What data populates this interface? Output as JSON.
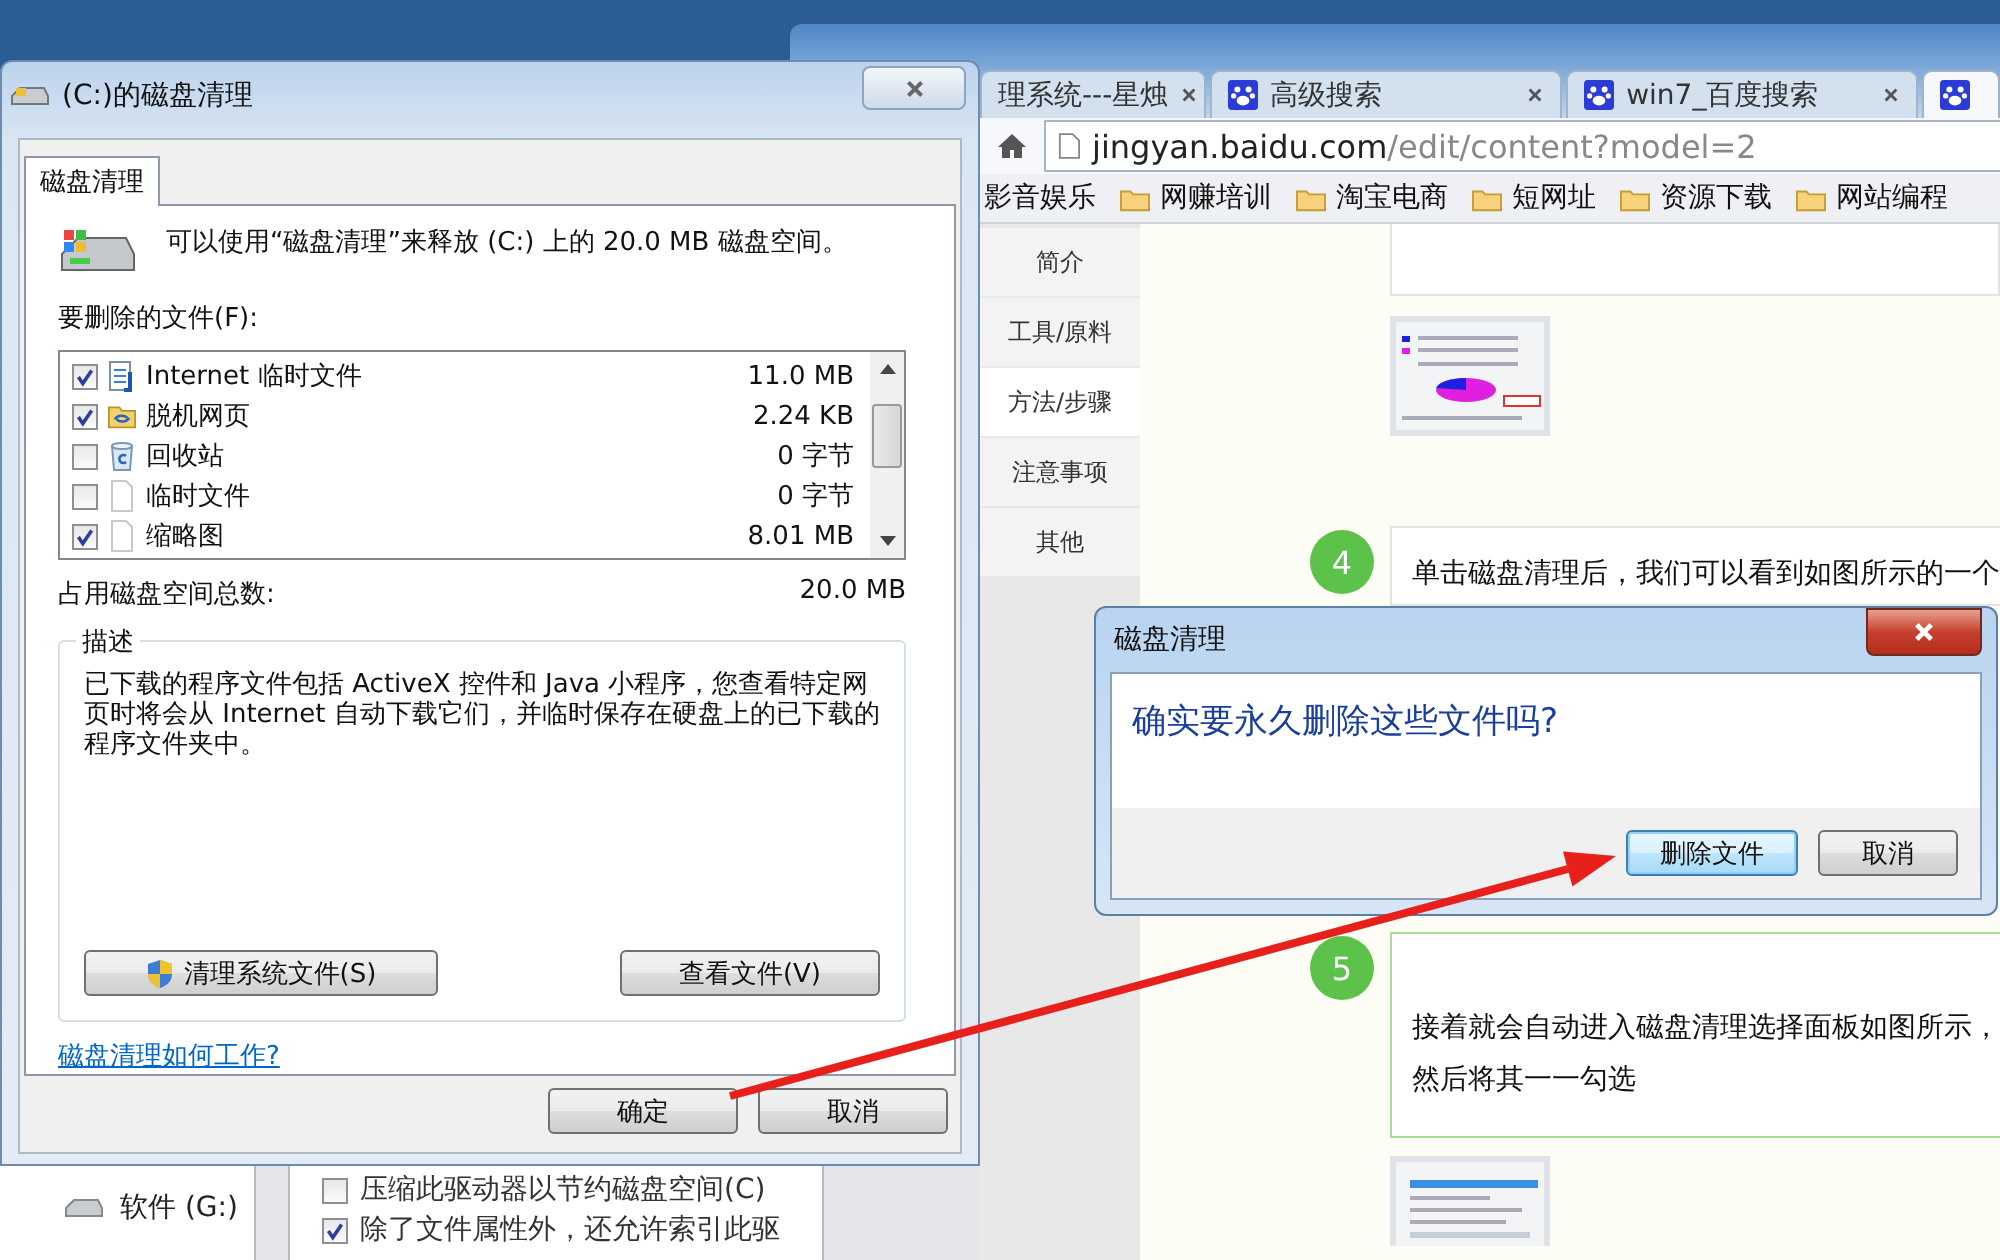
{
  "cleanup_dialog": {
    "title": "(C:)的磁盘清理",
    "tab": "磁盘清理",
    "summary": "可以使用“磁盘清理”来释放 (C:) 上的 20.0 MB 磁盘空间。",
    "files_label": "要删除的文件(F):",
    "files": [
      {
        "kind": "internet",
        "name": "Internet 临时文件",
        "size": "11.0 MB",
        "checked": true
      },
      {
        "kind": "offline",
        "name": "脱机网页",
        "size": "2.24 KB",
        "checked": true
      },
      {
        "kind": "recycle",
        "name": "回收站",
        "size": "0 字节",
        "checked": false
      },
      {
        "kind": "file",
        "name": "临时文件",
        "size": "0 字节",
        "checked": false
      },
      {
        "kind": "file",
        "name": "缩略图",
        "size": "8.01 MB",
        "checked": true
      }
    ],
    "total_label": "占用磁盘空间总数:",
    "total_value": "20.0 MB",
    "description_label": "描述",
    "description": "已下载的程序文件包括 ActiveX 控件和 Java 小程序，您查看特定网页时将会从 Internet 自动下载它们，并临时保存在硬盘上的已下载的程序文件夹中。",
    "system_files_button": "清理系统文件(S)",
    "view_files_button": "查看文件(V)",
    "help_link": "磁盘清理如何工作?",
    "ok_button": "确定",
    "cancel_button": "取消"
  },
  "browser": {
    "tabs": [
      {
        "title": "理系统---星烛",
        "icon": false,
        "close": true,
        "selected": false
      },
      {
        "title": "高级搜索",
        "icon": true,
        "close": true,
        "selected": false
      },
      {
        "title": "win7_百度搜索",
        "icon": true,
        "close": true,
        "selected": false
      },
      {
        "icon": true,
        "close": false,
        "selected": true
      }
    ],
    "url_host": "jingyan.baidu.com",
    "url_path": "/edit/content?model=2",
    "bookmarks": [
      {
        "label": "影音娱乐",
        "folder": false
      },
      {
        "label": "网赚培训",
        "folder": true
      },
      {
        "label": "淘宝电商",
        "folder": true
      },
      {
        "label": "短网址",
        "folder": true
      },
      {
        "label": "资源下载",
        "folder": true
      },
      {
        "label": "网站编程",
        "folder": true
      }
    ],
    "sidebar": [
      {
        "label": "简介",
        "selected": false
      },
      {
        "label": "工具/原料",
        "selected": false
      },
      {
        "label": "方法/步骤",
        "selected": true
      },
      {
        "label": "注意事项",
        "selected": false
      },
      {
        "label": "其他",
        "selected": false
      }
    ],
    "steps": [
      {
        "number": "4",
        "lines": [
          "单击磁盘清理后，我们可以看到如图所示的一个"
        ]
      },
      {
        "number": "5",
        "lines": [
          "接着就会自动进入磁盘清理选择面板如图所示，",
          "然后将其一一勾选"
        ]
      }
    ]
  },
  "confirm_dialog": {
    "title": "磁盘清理",
    "question": "确实要永久删除这些文件吗?",
    "delete_button": "删除文件",
    "cancel_button": "取消"
  },
  "background_window": {
    "drive": "软件 (G:)",
    "options": [
      {
        "label": "压缩此驱动器以节约磁盘空间(C)",
        "checked": false
      },
      {
        "label": "除了文件属性外，还允许索引此驱",
        "checked": true
      }
    ]
  }
}
